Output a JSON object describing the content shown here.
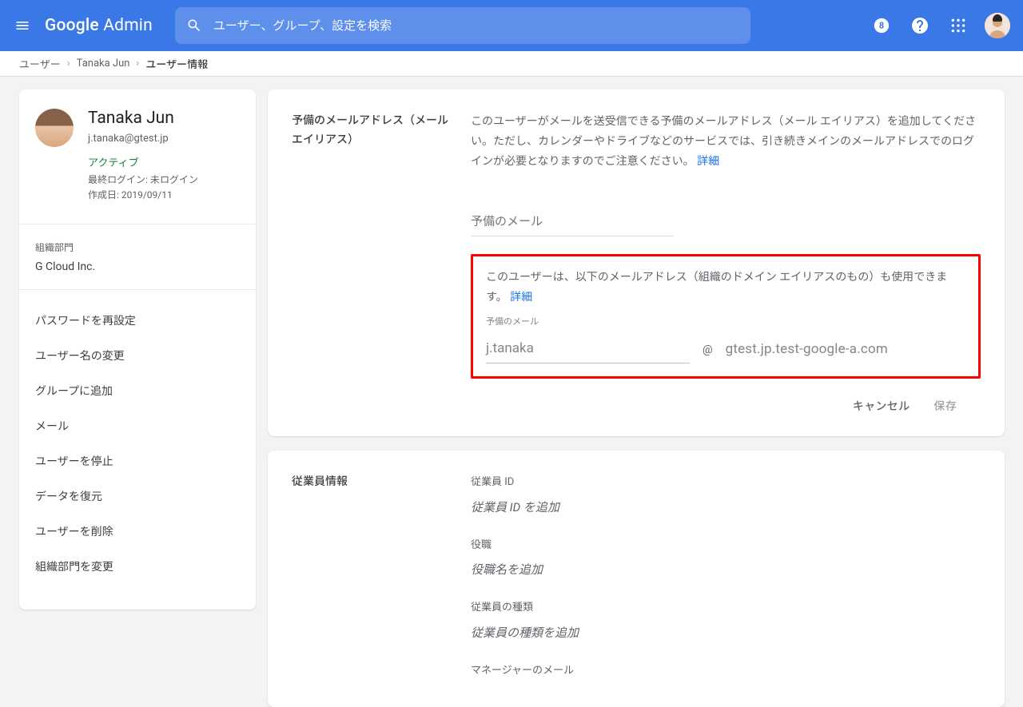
{
  "header": {
    "logo": "Google Admin",
    "search_placeholder": "ユーザー、グループ、設定を検索"
  },
  "breadcrumb": {
    "items": [
      "ユーザー",
      "Tanaka Jun"
    ],
    "current": "ユーザー情報"
  },
  "user": {
    "name": "Tanaka Jun",
    "email": "j.tanaka@gtest.jp",
    "status": "アクティブ",
    "last_login": "最終ログイン: 未ログイン",
    "created": "作成日: 2019/09/11"
  },
  "org": {
    "label": "組織部門",
    "value": "G Cloud Inc."
  },
  "side_actions": [
    "パスワードを再設定",
    "ユーザー名の変更",
    "グループに追加",
    "メール",
    "ユーザーを停止",
    "データを復元",
    "ユーザーを削除",
    "組織部門を変更"
  ],
  "alias": {
    "heading": "予備のメールアドレス（メール エイリアス）",
    "desc": "このユーザーがメールを送受信できる予備のメールアドレス（メール エイリアス）を追加してください。ただし、カレンダーやドライブなどのサービスでは、引き続きメインのメールアドレスでのログインが必要となりますのでご注意ください。",
    "details": "詳細",
    "placeholder": "予備のメール",
    "box_desc": "このユーザーは、以下のメールアドレス（組織のドメイン エイリアスのもの）も使用できます。",
    "box_label": "予備のメール",
    "local_part": "j.tanaka",
    "at": "@",
    "domain": "gtest.jp.test-google-a.com",
    "cancel": "キャンセル",
    "save": "保存"
  },
  "employee": {
    "heading": "従業員情報",
    "fields": [
      {
        "label": "従業員 ID",
        "value": "従業員 ID を追加"
      },
      {
        "label": "役職",
        "value": "役職名を追加"
      },
      {
        "label": "従業員の種類",
        "value": "従業員の種類を追加"
      },
      {
        "label": "マネージャーのメール",
        "value": ""
      }
    ]
  }
}
